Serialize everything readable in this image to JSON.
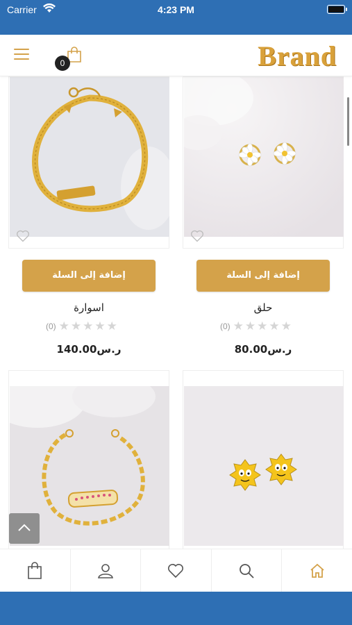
{
  "status_bar": {
    "carrier": "Carrier",
    "time": "4:23 PM"
  },
  "header": {
    "brand": "Brand",
    "cart_count": "0"
  },
  "theme": {
    "accent": "#d4a24a",
    "status_blue": "#2e6fb4"
  },
  "products": [
    {
      "name": "حلق",
      "price": "80.00ر.س",
      "add_to_cart": "إضافة إلى السلة",
      "rating_count": "(0)",
      "stars": 0,
      "image_icon": "daisy-rings"
    },
    {
      "name": "اسوارة",
      "price": "140.00ر.س",
      "add_to_cart": "إضافة إلى السلة",
      "rating_count": "(0)",
      "stars": 0,
      "image_icon": "gold-name-bracelet"
    },
    {
      "name": "",
      "price": "",
      "add_to_cart": "",
      "rating_count": "",
      "stars": 0,
      "image_icon": "cartoon-rings"
    },
    {
      "name": "",
      "price": "",
      "add_to_cart": "",
      "rating_count": "",
      "stars": 0,
      "image_icon": "kids-name-bracelet"
    }
  ],
  "tabbar": {
    "icons": [
      "home-icon",
      "search-icon",
      "heart-icon",
      "user-icon",
      "bag-icon"
    ]
  }
}
